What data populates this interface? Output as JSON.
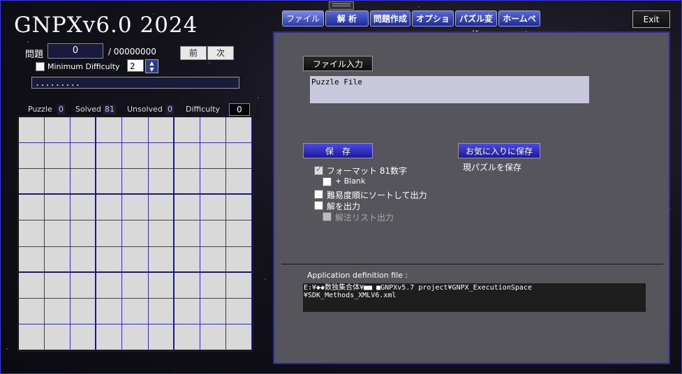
{
  "app": {
    "title": "GNPXv6.0 2024"
  },
  "problem": {
    "label": "問題",
    "value": "0",
    "total": "/ 00000000",
    "prev_label": "前",
    "next_label": "次"
  },
  "min_difficulty": {
    "checkbox_label": "Minimum Difficulty",
    "value": "2"
  },
  "puzzle_string": ".........",
  "stats": {
    "puzzle_label": "Puzzle",
    "puzzle_value": "0",
    "solved_label": "Solved",
    "solved_value": "81",
    "unsolved_label": "Unsolved",
    "unsolved_value": "0",
    "difficulty_label": "Difficulty",
    "difficulty_value": "0"
  },
  "tabs": [
    {
      "label": "ファイル",
      "active": true
    },
    {
      "label": "解 析",
      "active": false
    },
    {
      "label": "問題作成",
      "active": false
    },
    {
      "label": "オプション",
      "active": false
    },
    {
      "label": "パズル変換",
      "active": false
    },
    {
      "label": "ホームページ",
      "active": false
    }
  ],
  "exit_label": "Exit",
  "file_panel": {
    "file_input_label": "ファイル入力",
    "puzzle_file_text": "Puzzle File",
    "save_label": "保　存",
    "save_favorite_label": "お気に入りに保存",
    "save_current_label": "現パズルを保存",
    "format_label": "フォーマット 81数字",
    "blank_label": "+ Blank",
    "sort_label": "難易度順にソートして出力",
    "output_solution_label": "解を出力",
    "method_list_label": "解法リスト出力",
    "app_def_label": "Application definition file :",
    "app_def_line1": "E:¥◆◆数独集合体¥■■ ■GNPXv5.7 project¥GNPX_ExecutionSpace",
    "app_def_line2": "¥SDK_Methods_XMLV6.xml"
  },
  "colors": {
    "tab_blue": "#2a3aa8",
    "panel_bg": "#56555c",
    "grid_line": "#1a1a7a",
    "cell_bg": "#d9d9d9"
  }
}
